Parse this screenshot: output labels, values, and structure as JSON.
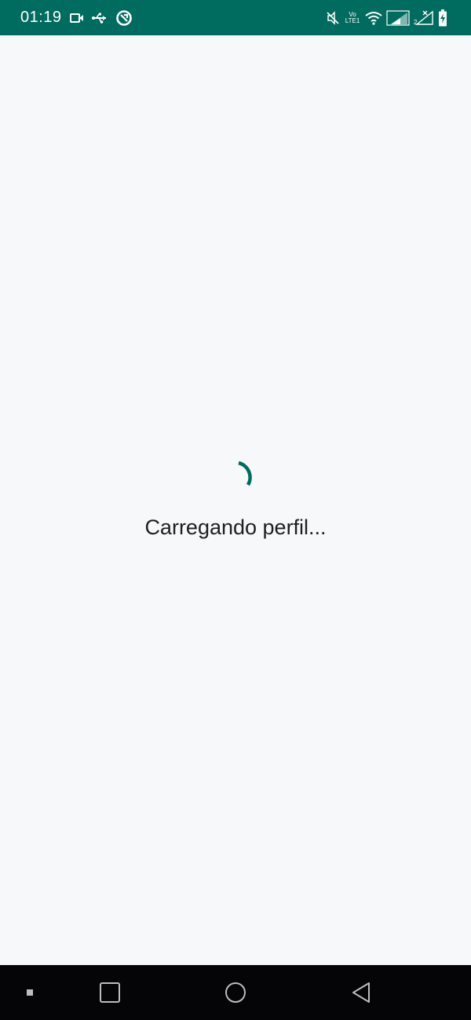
{
  "status_bar": {
    "time": "01:19",
    "volte_top": "Vo",
    "volte_bottom": "LTE1",
    "icons": [
      "video-camera-icon",
      "usb-icon",
      "data-saver-icon",
      "mute-icon",
      "volte-icon",
      "wifi-icon",
      "signal-sim1-icon",
      "signal-sim2-icon",
      "battery-charging-icon"
    ],
    "background": "#006c5f"
  },
  "main": {
    "loading_text": "Carregando perfil...",
    "spinner_color": "#006c5f",
    "background": "#f7f8fa"
  },
  "nav_bar": {
    "buttons": [
      "menu-dot-icon",
      "recents-icon",
      "home-icon",
      "back-icon"
    ],
    "background": "#050407"
  }
}
